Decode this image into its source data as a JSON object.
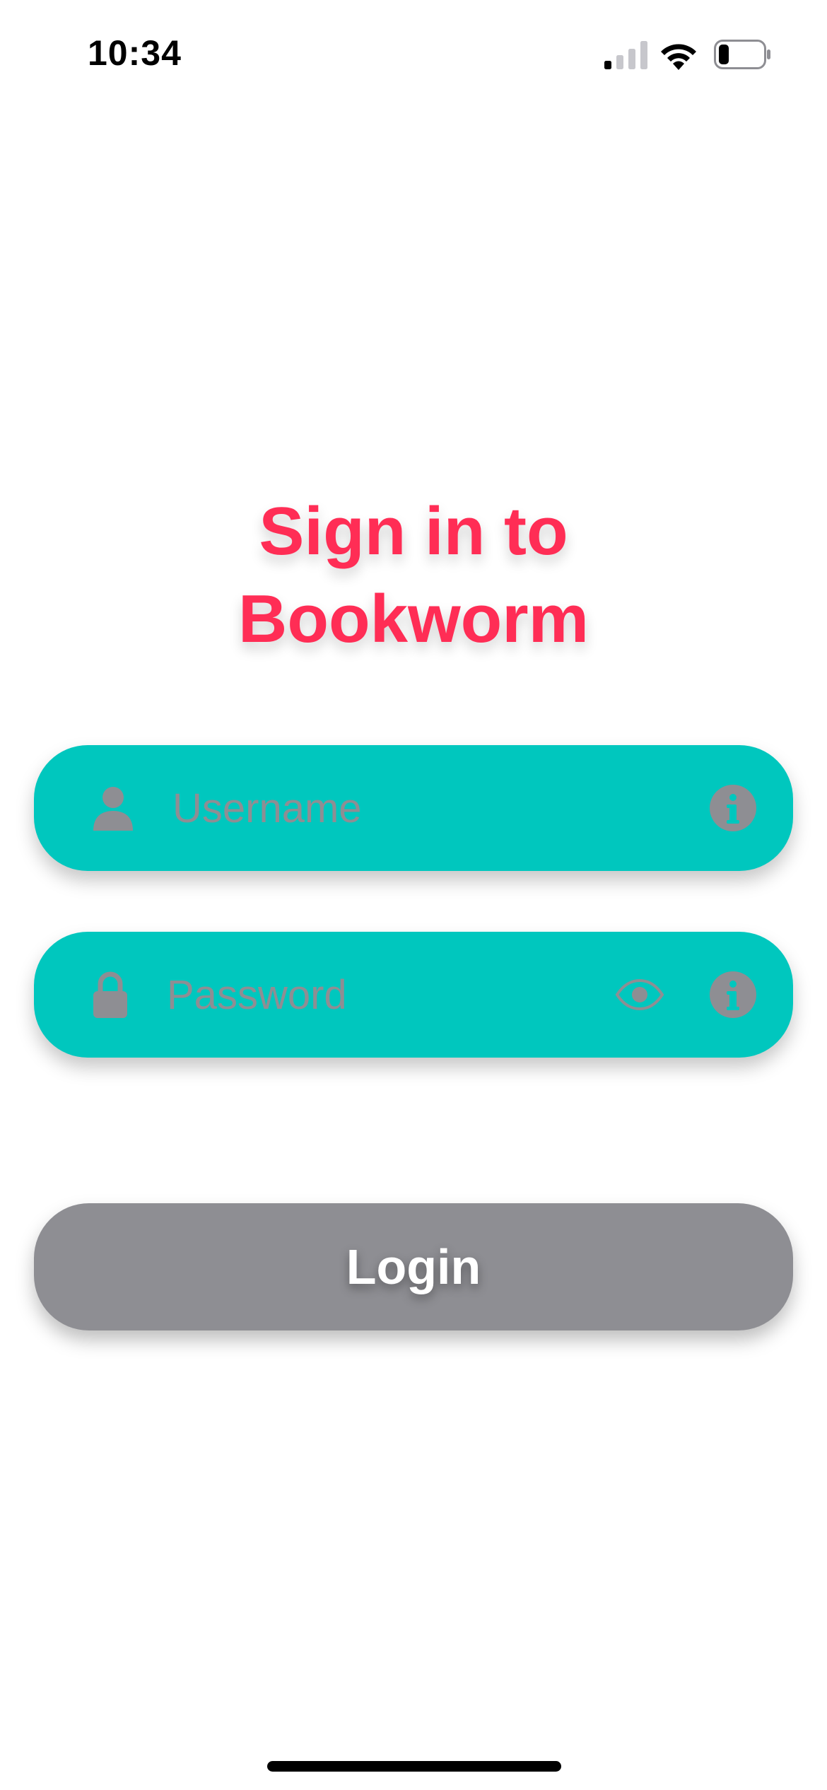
{
  "status_bar": {
    "time": "10:34",
    "icons": [
      "cellular-signal-icon",
      "wifi-icon",
      "battery-icon"
    ],
    "battery_level": 0.2
  },
  "title": {
    "line1": "Sign in to",
    "line2": "Bookworm",
    "color": "#ff2d55"
  },
  "form": {
    "field_background": "#00c7be",
    "username": {
      "placeholder": "Username",
      "value": "",
      "leading_icon": "person-icon",
      "trailing_icon": "info-icon"
    },
    "password": {
      "placeholder": "Password",
      "value": "",
      "leading_icon": "lock-icon",
      "trailing_icons": [
        "eye-icon",
        "info-icon"
      ]
    }
  },
  "login_button": {
    "label": "Login",
    "background": "#8e8e93"
  }
}
